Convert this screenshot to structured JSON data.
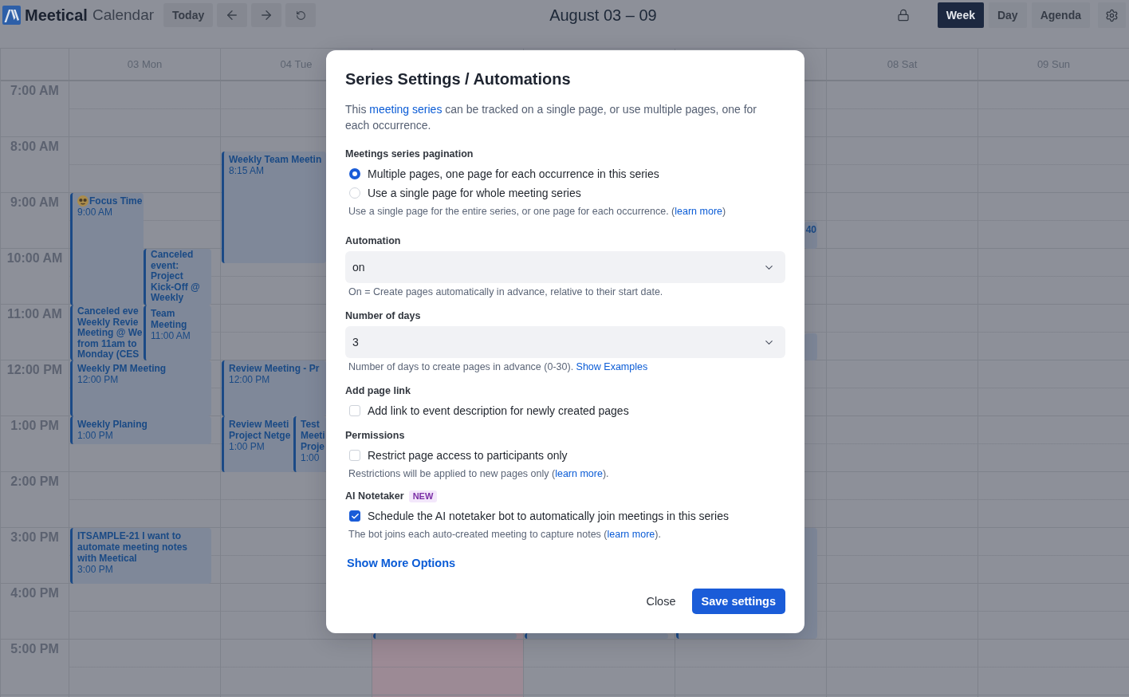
{
  "header": {
    "brand": "Meetical",
    "product": "Calendar",
    "today": "Today",
    "title": "August 03 – 09",
    "views": [
      {
        "label": "Week",
        "selected": true
      },
      {
        "label": "Day",
        "selected": false
      },
      {
        "label": "Agenda",
        "selected": false
      }
    ]
  },
  "calendar": {
    "hours": [
      "7:00 AM",
      "8:00 AM",
      "9:00 AM",
      "10:00 AM",
      "11:00 AM",
      "12:00 PM",
      "1:00 PM",
      "2:00 PM",
      "3:00 PM",
      "4:00 PM",
      "5:00 PM"
    ],
    "days": [
      {
        "label": "03 Mon",
        "today": false,
        "events": [
          {
            "kind": "focus",
            "title": "Focus Time",
            "time": "9:00 AM"
          },
          {
            "kind": "meeting",
            "title": "Canceled event: Project Kick-Off @ Weekly"
          },
          {
            "kind": "meeting",
            "title": "Canceled eve\nWeekly Revie\nMeeting @ We\nfrom 11am to\nMonday (CES"
          },
          {
            "kind": "meeting",
            "title": "Team Meeting",
            "time": "11:00 AM"
          },
          {
            "kind": "meeting",
            "title": "Weekly PM Meeting",
            "time": "12:00 PM"
          },
          {
            "kind": "meeting",
            "title": "Weekly Planing",
            "time": "1:00 PM"
          },
          {
            "kind": "meeting",
            "title": "ITSAMPLE-21 I want to automate meeting notes with Meetical",
            "time": "3:00 PM"
          }
        ]
      },
      {
        "label": "04 Tue",
        "today": false,
        "events": [
          {
            "kind": "meeting",
            "title": "Weekly Team Meetin",
            "time": "8:15 AM"
          },
          {
            "kind": "meeting",
            "title": "Review Meeting - Pr",
            "time": "12:00 PM"
          },
          {
            "kind": "meeting",
            "title": "Review Meeti\nProject Netge",
            "time": "1:00 PM"
          },
          {
            "kind": "meeting",
            "title": "Test\nMeeti\nProje",
            "time": "1:00"
          }
        ]
      },
      {
        "today": true,
        "events": [
          {
            "kind": "meeting"
          }
        ]
      },
      {
        "today": false,
        "events": [
          {
            "kind": "meeting"
          }
        ]
      },
      {
        "today": false,
        "events": [
          {
            "kind": "meeting",
            "title": "40"
          },
          {
            "kind": "meeting"
          },
          {
            "kind": "meeting"
          }
        ]
      },
      {
        "label": "08 Sat",
        "today": false
      },
      {
        "label": "09 Sun",
        "today": false
      }
    ]
  },
  "dialog": {
    "title": "Series Settings / Automations",
    "intro": {
      "text": "This ",
      "link": "meeting series",
      "after": " can be tracked on a single page, or use multiple pages, one for each occurrence."
    },
    "sections": [
      {
        "kind": "radio",
        "label": "Meetings series pagination",
        "options": [
          {
            "label": "Multiple pages, one page for each occurrence in this series",
            "selected": true
          },
          {
            "label": "Use a single page for whole meeting series",
            "selected": false
          }
        ],
        "help": {
          "text": "Use a single page for the entire series, or one page for each occurrence. (",
          "link": "learn more",
          "after": ")"
        }
      },
      {
        "kind": "select",
        "label": "Automation",
        "value": "on",
        "help": {
          "text": "On = Create pages automatically in advance, relative to their start date."
        }
      },
      {
        "kind": "select",
        "label": "Number of days",
        "value": "3",
        "help": {
          "text": "Number of days to create pages in advance (0-30). ",
          "link": "Show Examples"
        }
      },
      {
        "kind": "checkbox",
        "label": "Add page link",
        "option": {
          "label": "Add link to event description for newly created pages",
          "checked": false
        }
      },
      {
        "kind": "checkbox",
        "label": "Permissions",
        "option": {
          "label": "Restrict page access to participants only",
          "checked": false
        },
        "help": {
          "text": "Restrictions will be applied to new pages only (",
          "link": "learn more",
          "after": ")."
        }
      },
      {
        "kind": "checkbox",
        "label": "AI Notetaker",
        "badge": "NEW",
        "option": {
          "label": "Schedule the AI notetaker bot to automatically join meetings in this series",
          "checked": true
        },
        "help": {
          "text": "The bot joins each auto-created meeting to capture notes (",
          "link": "learn more",
          "after": ")."
        }
      }
    ],
    "more_link": "Show More Options",
    "actions": [
      {
        "kind": "secondary",
        "label": "Close"
      },
      {
        "kind": "primary",
        "label": "Save settings"
      }
    ]
  }
}
